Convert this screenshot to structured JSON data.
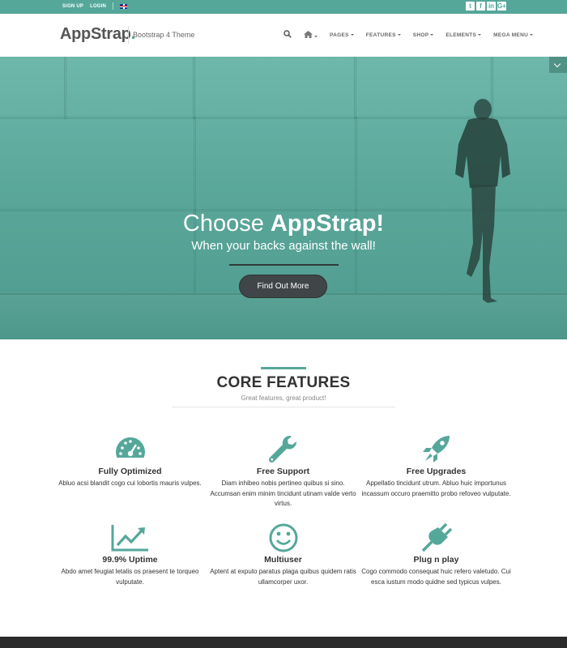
{
  "topbar": {
    "sign_up": "SIGN UP",
    "login": "LOGIN",
    "social": [
      "twitter-icon",
      "facebook-icon",
      "linkedin-icon",
      "googleplus-icon"
    ]
  },
  "header": {
    "logo_main": "AppStrap",
    "logo_dot": ".",
    "tagline": "Bootstrap 4 Theme",
    "nav": [
      "PAGES",
      "FEATURES",
      "SHOP",
      "ELEMENTS",
      "MEGA MENU"
    ]
  },
  "hero": {
    "title_light": "Choose ",
    "title_bold": "AppStrap!",
    "subtitle": "When your backs against the wall!",
    "button": "Find Out More"
  },
  "features": {
    "heading": "CORE FEATURES",
    "subheading": "Great features, great product!",
    "items": [
      {
        "title": "Fully Optimized",
        "desc": "Abluo acsi blandit cogo cui lobortis mauris vulpes.",
        "icon": "dashboard-icon"
      },
      {
        "title": "Free Support",
        "desc": "Diam inhibeo nobis pertineo quibus si sino. Accumsan enim minim tincidunt utinam valde verto virtus.",
        "icon": "wrench-icon"
      },
      {
        "title": "Free Upgrades",
        "desc": "Appellatio tincidunt utrum. Abluo huic importunus incassum occuro praemitto probo refoveo vulputate.",
        "icon": "rocket-icon"
      },
      {
        "title": "99.9% Uptime",
        "desc": "Abdo amet feugiat letalis os praesent te torqueo vulputate.",
        "icon": "line-chart-icon"
      },
      {
        "title": "Multiuser",
        "desc": "Aptent at exputo paratus plaga quibus quidem ratis ullamcorper uxor.",
        "icon": "smile-icon"
      },
      {
        "title": "Plug n play",
        "desc": "Cogo commodo consequat huic refero valetudo. Cui esca iustum modo quidne sed typicus vulpes.",
        "icon": "plug-icon"
      }
    ]
  },
  "colors": {
    "accent": "#55a79a",
    "dark_button": "#404647",
    "footer": "#2b2b2b"
  }
}
